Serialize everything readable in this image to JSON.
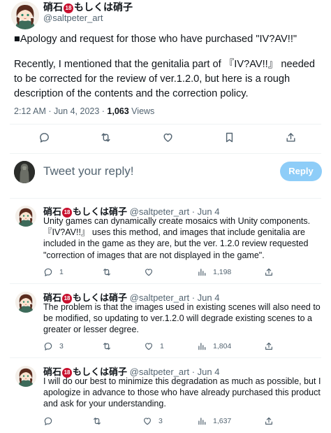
{
  "author": {
    "name_prefix": "硝石",
    "badge": "18",
    "name_suffix": "もしくは硝子",
    "handle": "@saltpeter_art"
  },
  "main_tweet": {
    "line1": "■Apology and request for those who have purchased \"IV?AV!!\"",
    "line2": "Recently, I mentioned that the genitalia part of 『IV?AV!!』 needed to be corrected for the review of ver.1.2.0, but here is a rough description of the contents and the correction policy.",
    "time": "2:12 AM · Jun 4, 2023 · ",
    "views_count": "1,063",
    "views_label": " Views"
  },
  "reply_box": {
    "placeholder": "Tweet your reply!",
    "button": "Reply"
  },
  "replies": [
    {
      "handle_date": " @saltpeter_art · Jun 4",
      "text": "Unity games can dynamically create mosaics with Unity components. 『IV?AV!!』 uses this method, and images that include genitalia are included in the game as they are, but the ver. 1.2.0 review requested \"correction of images that are not displayed in the game\".",
      "replies": "1",
      "retweets": "",
      "likes": "",
      "views": "1,198"
    },
    {
      "handle_date": " @saltpeter_art · Jun 4",
      "text": "The problem is that the images used in existing scenes will also need to be modified, so updating to ver.1.2.0 will degrade existing scenes to a greater or lesser degree.",
      "replies": "3",
      "retweets": "",
      "likes": "1",
      "views": "1,804"
    },
    {
      "handle_date": " @saltpeter_art · Jun 4",
      "text": "I will do our best to minimize this degradation as much as possible, but I apologize in advance to those who have already purchased this product and ask for your understanding.",
      "replies": "",
      "retweets": "",
      "likes": "3",
      "views": "1,637"
    }
  ],
  "icons": [
    "reply-icon",
    "retweet-icon",
    "like-icon",
    "bookmark-icon",
    "share-icon",
    "views-icon"
  ],
  "colors": {
    "accent": "#1d9bf0",
    "reply_button": "#8ecdf8",
    "badge": "#c8102e",
    "muted": "#536471"
  }
}
